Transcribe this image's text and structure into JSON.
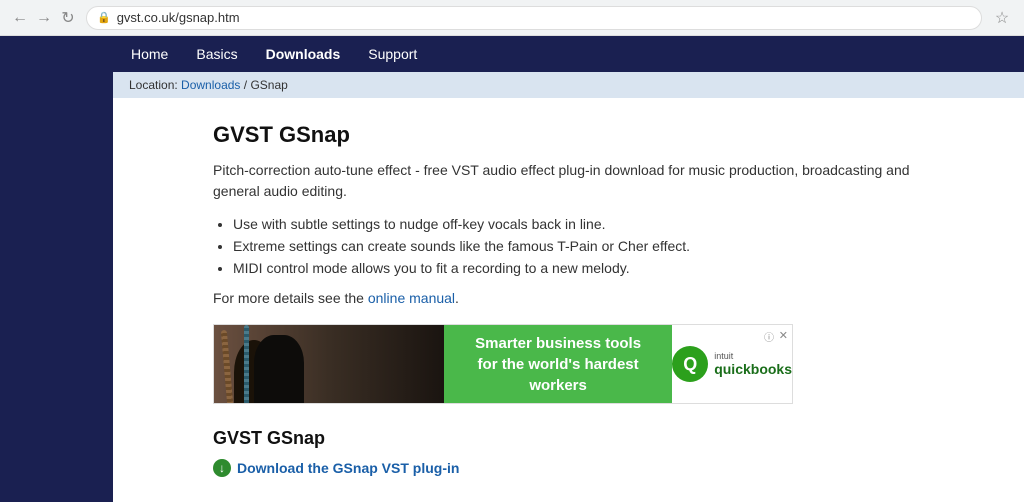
{
  "browser": {
    "url": "gvst.co.uk/gsnap.htm",
    "back_disabled": false,
    "forward_disabled": false,
    "reload_label": "↻"
  },
  "nav": {
    "items": [
      {
        "label": "Home",
        "active": false
      },
      {
        "label": "Basics",
        "active": false
      },
      {
        "label": "Downloads",
        "active": true
      },
      {
        "label": "Support",
        "active": false
      }
    ]
  },
  "breadcrumb": {
    "prefix": "Location: ",
    "link_text": "Downloads",
    "separator": " / ",
    "current": "GSnap"
  },
  "page": {
    "title": "GVST GSnap",
    "description": "Pitch-correction auto-tune effect - free VST audio effect plug-in download for music production, broadcasting and general audio editing.",
    "bullets": [
      "Use with subtle settings to nudge off-key vocals back in line.",
      "Extreme settings can create sounds like the famous T-Pain or Cher effect.",
      "MIDI control mode allows you to fit a recording to a new melody."
    ],
    "manual_prefix": "For more details see the ",
    "manual_link": "online manual",
    "manual_suffix": "."
  },
  "ad": {
    "green_text_line1": "Smarter business tools",
    "green_text_line2": "for the world's hardest workers",
    "intuit_label": "intuit",
    "qb_label": "quickbooks",
    "info_symbol": "ⓘ",
    "close_symbol": "✕"
  },
  "download_section": {
    "title": "GVST GSnap",
    "link_text": "Download the GSnap VST plug-in",
    "download_icon": "↓"
  }
}
